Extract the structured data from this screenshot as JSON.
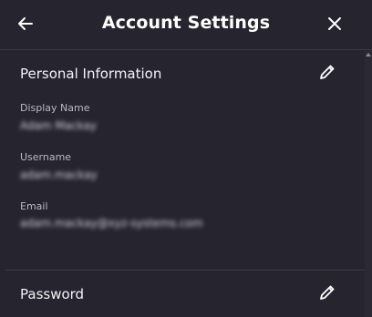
{
  "header": {
    "title": "Account Settings",
    "back_icon": "arrow-left-icon",
    "close_icon": "close-icon"
  },
  "personal_info": {
    "title": "Personal Information",
    "edit_icon": "pencil-icon",
    "fields": [
      {
        "label": "Display Name",
        "value": "Adam Mackay"
      },
      {
        "label": "Username",
        "value": "adam.mackay"
      },
      {
        "label": "Email",
        "value": "adam.mackay@xyz-systems.com"
      }
    ]
  },
  "password": {
    "title": "Password",
    "edit_icon": "pencil-icon"
  },
  "colors": {
    "background": "#26252f",
    "divider": "#3a3945",
    "label": "#b9b8c3",
    "text": "#ffffff"
  }
}
